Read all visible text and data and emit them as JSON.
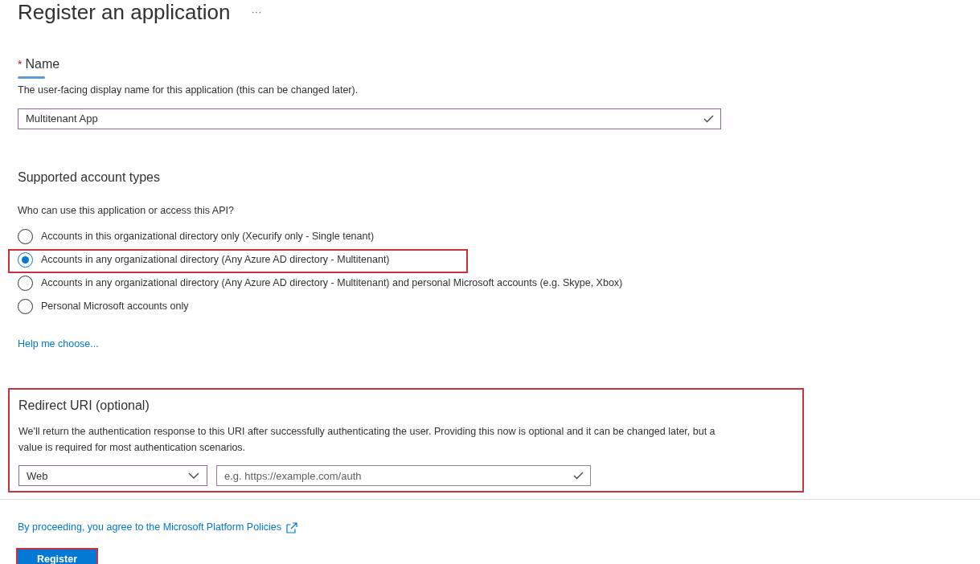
{
  "page": {
    "title": "Register an application",
    "more": "···"
  },
  "name_field": {
    "label": "Name",
    "required_mark": "*",
    "description": "The user-facing display name for this application (this can be changed later).",
    "value": "Multitenant App"
  },
  "account_types": {
    "heading": "Supported account types",
    "question": "Who can use this application or access this API?",
    "options": [
      {
        "label": "Accounts in this organizational directory only (Xecurify only - Single tenant)",
        "selected": false,
        "highlighted": false
      },
      {
        "label": "Accounts in any organizational directory (Any Azure AD directory - Multitenant)",
        "selected": true,
        "highlighted": true
      },
      {
        "label": "Accounts in any organizational directory (Any Azure AD directory - Multitenant) and personal Microsoft accounts (e.g. Skype, Xbox)",
        "selected": false,
        "highlighted": false
      },
      {
        "label": "Personal Microsoft accounts only",
        "selected": false,
        "highlighted": false
      }
    ],
    "help_link": "Help me choose..."
  },
  "redirect": {
    "heading": "Redirect URI (optional)",
    "highlighted": true,
    "description": "We'll return the authentication response to this URI after successfully authenticating the user. Providing this now is optional and it can be changed later, but a value is required for most authentication scenarios.",
    "platform": "Web",
    "placeholder": "e.g. https://example.com/auth"
  },
  "footer": {
    "policy_link": "By proceeding, you agree to the Microsoft Platform Policies",
    "register_button": "Register",
    "register_highlighted": true
  }
}
